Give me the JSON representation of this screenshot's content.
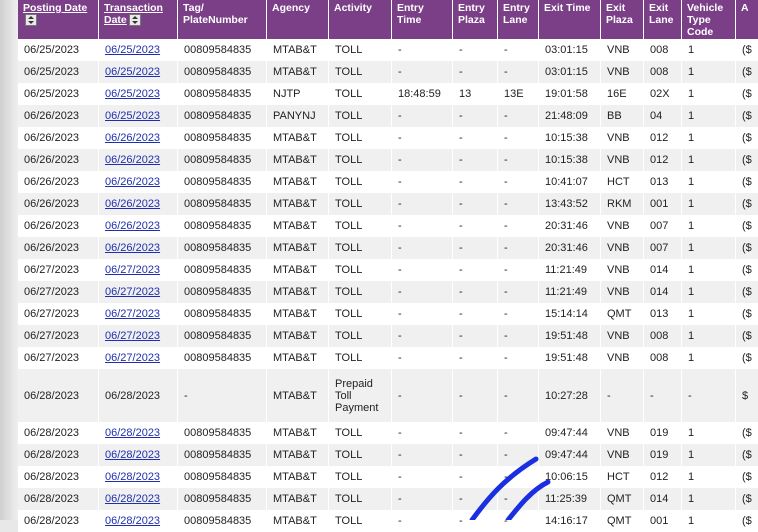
{
  "columns": [
    {
      "key": "posting_date",
      "label": "Posting Date",
      "sortable": true
    },
    {
      "key": "transaction_date",
      "label": "Transaction Date",
      "sortable": true
    },
    {
      "key": "tag_plate",
      "label": "Tag/ PlateNumber",
      "sortable": false
    },
    {
      "key": "agency",
      "label": "Agency",
      "sortable": false
    },
    {
      "key": "activity",
      "label": "Activity",
      "sortable": false
    },
    {
      "key": "entry_time",
      "label": "Entry Time",
      "sortable": false
    },
    {
      "key": "entry_plaza",
      "label": "Entry Plaza",
      "sortable": false
    },
    {
      "key": "entry_lane",
      "label": "Entry Lane",
      "sortable": false
    },
    {
      "key": "exit_time",
      "label": "Exit Time",
      "sortable": false
    },
    {
      "key": "exit_plaza",
      "label": "Exit Plaza",
      "sortable": false
    },
    {
      "key": "exit_lane",
      "label": "Exit Lane",
      "sortable": false
    },
    {
      "key": "vehicle_type",
      "label": "Vehicle Type Code",
      "sortable": false
    },
    {
      "key": "amount",
      "label": "A",
      "sortable": false
    }
  ],
  "rows": [
    {
      "posting_date": "06/25/2023",
      "transaction_date": "06/25/2023",
      "tag_plate": "00809584835",
      "agency": "MTAB&T",
      "activity": "TOLL",
      "entry_time": "-",
      "entry_plaza": "-",
      "entry_lane": "-",
      "exit_time": "03:01:15",
      "exit_plaza": "VNB",
      "exit_lane": "008",
      "vehicle_type": "1",
      "amount": "($"
    },
    {
      "posting_date": "06/25/2023",
      "transaction_date": "06/25/2023",
      "tag_plate": "00809584835",
      "agency": "MTAB&T",
      "activity": "TOLL",
      "entry_time": "-",
      "entry_plaza": "-",
      "entry_lane": "-",
      "exit_time": "03:01:15",
      "exit_plaza": "VNB",
      "exit_lane": "008",
      "vehicle_type": "1",
      "amount": "($"
    },
    {
      "posting_date": "06/25/2023",
      "transaction_date": "06/25/2023",
      "tag_plate": "00809584835",
      "agency": "NJTP",
      "activity": "TOLL",
      "entry_time": "18:48:59",
      "entry_plaza": "13",
      "entry_lane": "13E",
      "exit_time": "19:01:58",
      "exit_plaza": "16E",
      "exit_lane": "02X",
      "vehicle_type": "1",
      "amount": "($"
    },
    {
      "posting_date": "06/26/2023",
      "transaction_date": "06/25/2023",
      "tag_plate": "00809584835",
      "agency": "PANYNJ",
      "activity": "TOLL",
      "entry_time": "-",
      "entry_plaza": "-",
      "entry_lane": "-",
      "exit_time": "21:48:09",
      "exit_plaza": "BB",
      "exit_lane": "04",
      "vehicle_type": "1",
      "amount": "($"
    },
    {
      "posting_date": "06/26/2023",
      "transaction_date": "06/26/2023",
      "tag_plate": "00809584835",
      "agency": "MTAB&T",
      "activity": "TOLL",
      "entry_time": "-",
      "entry_plaza": "-",
      "entry_lane": "-",
      "exit_time": "10:15:38",
      "exit_plaza": "VNB",
      "exit_lane": "012",
      "vehicle_type": "1",
      "amount": "($"
    },
    {
      "posting_date": "06/26/2023",
      "transaction_date": "06/26/2023",
      "tag_plate": "00809584835",
      "agency": "MTAB&T",
      "activity": "TOLL",
      "entry_time": "-",
      "entry_plaza": "-",
      "entry_lane": "-",
      "exit_time": "10:15:38",
      "exit_plaza": "VNB",
      "exit_lane": "012",
      "vehicle_type": "1",
      "amount": "($"
    },
    {
      "posting_date": "06/26/2023",
      "transaction_date": "06/26/2023",
      "tag_plate": "00809584835",
      "agency": "MTAB&T",
      "activity": "TOLL",
      "entry_time": "-",
      "entry_plaza": "-",
      "entry_lane": "-",
      "exit_time": "10:41:07",
      "exit_plaza": "HCT",
      "exit_lane": "013",
      "vehicle_type": "1",
      "amount": "($"
    },
    {
      "posting_date": "06/26/2023",
      "transaction_date": "06/26/2023",
      "tag_plate": "00809584835",
      "agency": "MTAB&T",
      "activity": "TOLL",
      "entry_time": "-",
      "entry_plaza": "-",
      "entry_lane": "-",
      "exit_time": "13:43:52",
      "exit_plaza": "RKM",
      "exit_lane": "001",
      "vehicle_type": "1",
      "amount": "($"
    },
    {
      "posting_date": "06/26/2023",
      "transaction_date": "06/26/2023",
      "tag_plate": "00809584835",
      "agency": "MTAB&T",
      "activity": "TOLL",
      "entry_time": "-",
      "entry_plaza": "-",
      "entry_lane": "-",
      "exit_time": "20:31:46",
      "exit_plaza": "VNB",
      "exit_lane": "007",
      "vehicle_type": "1",
      "amount": "($"
    },
    {
      "posting_date": "06/26/2023",
      "transaction_date": "06/26/2023",
      "tag_plate": "00809584835",
      "agency": "MTAB&T",
      "activity": "TOLL",
      "entry_time": "-",
      "entry_plaza": "-",
      "entry_lane": "-",
      "exit_time": "20:31:46",
      "exit_plaza": "VNB",
      "exit_lane": "007",
      "vehicle_type": "1",
      "amount": "($"
    },
    {
      "posting_date": "06/27/2023",
      "transaction_date": "06/27/2023",
      "tag_plate": "00809584835",
      "agency": "MTAB&T",
      "activity": "TOLL",
      "entry_time": "-",
      "entry_plaza": "-",
      "entry_lane": "-",
      "exit_time": "11:21:49",
      "exit_plaza": "VNB",
      "exit_lane": "014",
      "vehicle_type": "1",
      "amount": "($"
    },
    {
      "posting_date": "06/27/2023",
      "transaction_date": "06/27/2023",
      "tag_plate": "00809584835",
      "agency": "MTAB&T",
      "activity": "TOLL",
      "entry_time": "-",
      "entry_plaza": "-",
      "entry_lane": "-",
      "exit_time": "11:21:49",
      "exit_plaza": "VNB",
      "exit_lane": "014",
      "vehicle_type": "1",
      "amount": "($"
    },
    {
      "posting_date": "06/27/2023",
      "transaction_date": "06/27/2023",
      "tag_plate": "00809584835",
      "agency": "MTAB&T",
      "activity": "TOLL",
      "entry_time": "-",
      "entry_plaza": "-",
      "entry_lane": "-",
      "exit_time": "15:14:14",
      "exit_plaza": "QMT",
      "exit_lane": "013",
      "vehicle_type": "1",
      "amount": "($"
    },
    {
      "posting_date": "06/27/2023",
      "transaction_date": "06/27/2023",
      "tag_plate": "00809584835",
      "agency": "MTAB&T",
      "activity": "TOLL",
      "entry_time": "-",
      "entry_plaza": "-",
      "entry_lane": "-",
      "exit_time": "19:51:48",
      "exit_plaza": "VNB",
      "exit_lane": "008",
      "vehicle_type": "1",
      "amount": "($"
    },
    {
      "posting_date": "06/27/2023",
      "transaction_date": "06/27/2023",
      "tag_plate": "00809584835",
      "agency": "MTAB&T",
      "activity": "TOLL",
      "entry_time": "-",
      "entry_plaza": "-",
      "entry_lane": "-",
      "exit_time": "19:51:48",
      "exit_plaza": "VNB",
      "exit_lane": "008",
      "vehicle_type": "1",
      "amount": "($"
    },
    {
      "posting_date": "06/28/2023",
      "transaction_date": "06/28/2023",
      "tag_plate": "-",
      "agency": "MTAB&T",
      "activity": "Prepaid Toll Payment",
      "entry_time": "-",
      "entry_plaza": "-",
      "entry_lane": "-",
      "exit_time": "10:27:28",
      "exit_plaza": "-",
      "exit_lane": "-",
      "vehicle_type": "-",
      "amount": "$",
      "tall": true,
      "plain_link": true
    },
    {
      "posting_date": "06/28/2023",
      "transaction_date": "06/28/2023",
      "tag_plate": "00809584835",
      "agency": "MTAB&T",
      "activity": "TOLL",
      "entry_time": "-",
      "entry_plaza": "-",
      "entry_lane": "-",
      "exit_time": "09:47:44",
      "exit_plaza": "VNB",
      "exit_lane": "019",
      "vehicle_type": "1",
      "amount": "($"
    },
    {
      "posting_date": "06/28/2023",
      "transaction_date": "06/28/2023",
      "tag_plate": "00809584835",
      "agency": "MTAB&T",
      "activity": "TOLL",
      "entry_time": "-",
      "entry_plaza": "-",
      "entry_lane": "-",
      "exit_time": "09:47:44",
      "exit_plaza": "VNB",
      "exit_lane": "019",
      "vehicle_type": "1",
      "amount": "($"
    },
    {
      "posting_date": "06/28/2023",
      "transaction_date": "06/28/2023",
      "tag_plate": "00809584835",
      "agency": "MTAB&T",
      "activity": "TOLL",
      "entry_time": "-",
      "entry_plaza": "-",
      "entry_lane": "-",
      "exit_time": "10:06:15",
      "exit_plaza": "HCT",
      "exit_lane": "012",
      "vehicle_type": "1",
      "amount": "($"
    },
    {
      "posting_date": "06/28/2023",
      "transaction_date": "06/28/2023",
      "tag_plate": "00809584835",
      "agency": "MTAB&T",
      "activity": "TOLL",
      "entry_time": "-",
      "entry_plaza": "-",
      "entry_lane": "-",
      "exit_time": "11:25:39",
      "exit_plaza": "QMT",
      "exit_lane": "014",
      "vehicle_type": "1",
      "amount": "($"
    },
    {
      "posting_date": "06/28/2023",
      "transaction_date": "06/28/2023",
      "tag_plate": "00809584835",
      "agency": "MTAB&T",
      "activity": "TOLL",
      "entry_time": "-",
      "entry_plaza": "-",
      "entry_lane": "-",
      "exit_time": "14:16:17",
      "exit_plaza": "QMT",
      "exit_lane": "001",
      "vehicle_type": "1",
      "amount": "($"
    }
  ],
  "annotation": {
    "color": "#1a2fe0"
  }
}
